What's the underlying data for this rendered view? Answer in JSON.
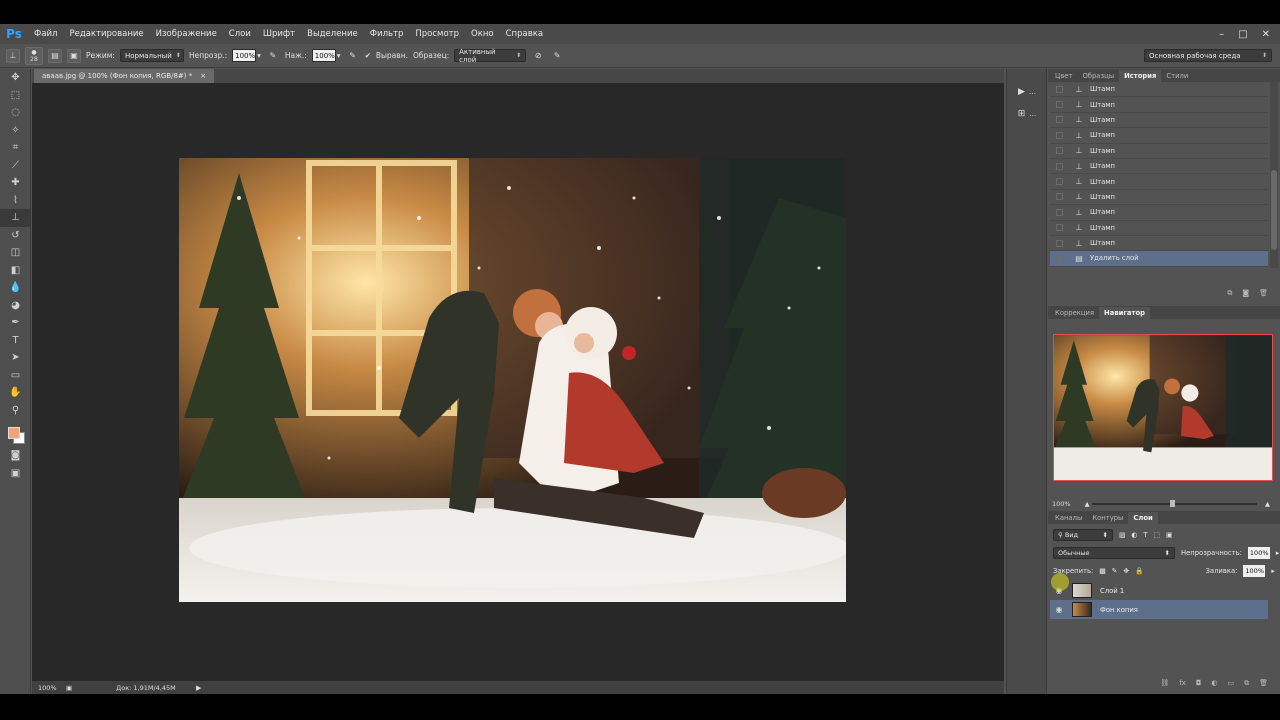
{
  "app": {
    "logo": "Ps"
  },
  "menu": [
    "Файл",
    "Редактирование",
    "Изображение",
    "Слои",
    "Шрифт",
    "Выделение",
    "Фильтр",
    "Просмотр",
    "Окно",
    "Справка"
  ],
  "window_controls": [
    "–",
    "□",
    "✕"
  ],
  "options": {
    "brush_size": "28",
    "mode_label": "Режим:",
    "mode_value": "Нормальный",
    "opacity_label": "Непрозр.:",
    "opacity_value": "100%",
    "flow_label": "Наж.:",
    "flow_value": "100%",
    "aligned_label": "Выравн.",
    "sample_label": "Образец:",
    "sample_value": "Активный слой",
    "workspace": "Основная рабочая среда"
  },
  "document": {
    "tab_title": "аваав.jpg @ 100% (Фон копия, RGB/8#) *",
    "status_zoom": "100%",
    "status_info": "Док: 1,91M/4,45M"
  },
  "history_panel": {
    "tabs": [
      "Цвет",
      "Образцы",
      "История",
      "Стили"
    ],
    "active_tab": "История",
    "rows": [
      "Штамп",
      "Штамп",
      "Штамп",
      "Штамп",
      "Штамп",
      "Штамп",
      "Штамп",
      "Штамп",
      "Штамп",
      "Штамп",
      "Штамп",
      "Удалить слой"
    ]
  },
  "navigator_panel": {
    "tabs": [
      "Коррекция",
      "Навигатор"
    ],
    "active_tab": "Навигатор",
    "zoom": "100%"
  },
  "layers_panel": {
    "tabs": [
      "Каналы",
      "Контуры",
      "Слои"
    ],
    "active_tab": "Слои",
    "filter": "Вид",
    "blend_mode": "Обычные",
    "opacity_label": "Непрозрачность:",
    "opacity_value": "100%",
    "lock_label": "Закрепить:",
    "fill_label": "Заливка:",
    "fill_value": "100%",
    "layers": [
      {
        "name": "Слой 1"
      },
      {
        "name": "Фон копия"
      }
    ]
  },
  "colors": {
    "foreground": "#f2a379",
    "background": "#ffffff",
    "selection": "#5d6f8a",
    "accent": "#2fa3ff"
  }
}
